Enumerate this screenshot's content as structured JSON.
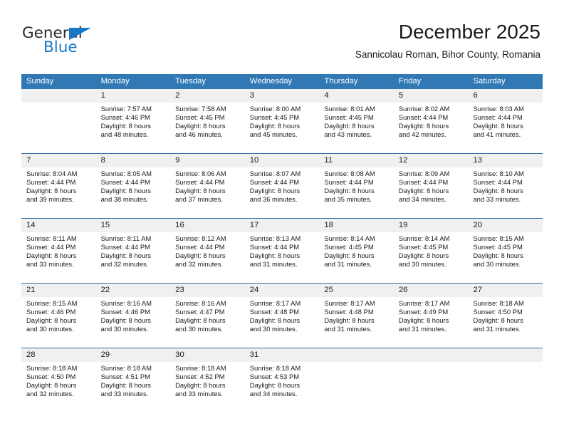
{
  "logo": {
    "word_top": "General",
    "word_bottom": "Blue",
    "brand_color": "#1878c8",
    "triangle_icon": "triangle-icon"
  },
  "header": {
    "month_title": "December 2025",
    "location": "Sannicolau Roman, Bihor County, Romania"
  },
  "calendar": {
    "header_bg": "#3079b5",
    "daynum_bg": "#f0f0f0",
    "grid_line_color": "#2f6fa8",
    "weekdays": [
      "Sunday",
      "Monday",
      "Tuesday",
      "Wednesday",
      "Thursday",
      "Friday",
      "Saturday"
    ],
    "weeks": [
      [
        {
          "day": "",
          "lines": []
        },
        {
          "day": "1",
          "lines": [
            "Sunrise: 7:57 AM",
            "Sunset: 4:46 PM",
            "Daylight: 8 hours",
            "and 48 minutes."
          ]
        },
        {
          "day": "2",
          "lines": [
            "Sunrise: 7:58 AM",
            "Sunset: 4:45 PM",
            "Daylight: 8 hours",
            "and 46 minutes."
          ]
        },
        {
          "day": "3",
          "lines": [
            "Sunrise: 8:00 AM",
            "Sunset: 4:45 PM",
            "Daylight: 8 hours",
            "and 45 minutes."
          ]
        },
        {
          "day": "4",
          "lines": [
            "Sunrise: 8:01 AM",
            "Sunset: 4:45 PM",
            "Daylight: 8 hours",
            "and 43 minutes."
          ]
        },
        {
          "day": "5",
          "lines": [
            "Sunrise: 8:02 AM",
            "Sunset: 4:44 PM",
            "Daylight: 8 hours",
            "and 42 minutes."
          ]
        },
        {
          "day": "6",
          "lines": [
            "Sunrise: 8:03 AM",
            "Sunset: 4:44 PM",
            "Daylight: 8 hours",
            "and 41 minutes."
          ]
        }
      ],
      [
        {
          "day": "7",
          "lines": [
            "Sunrise: 8:04 AM",
            "Sunset: 4:44 PM",
            "Daylight: 8 hours",
            "and 39 minutes."
          ]
        },
        {
          "day": "8",
          "lines": [
            "Sunrise: 8:05 AM",
            "Sunset: 4:44 PM",
            "Daylight: 8 hours",
            "and 38 minutes."
          ]
        },
        {
          "day": "9",
          "lines": [
            "Sunrise: 8:06 AM",
            "Sunset: 4:44 PM",
            "Daylight: 8 hours",
            "and 37 minutes."
          ]
        },
        {
          "day": "10",
          "lines": [
            "Sunrise: 8:07 AM",
            "Sunset: 4:44 PM",
            "Daylight: 8 hours",
            "and 36 minutes."
          ]
        },
        {
          "day": "11",
          "lines": [
            "Sunrise: 8:08 AM",
            "Sunset: 4:44 PM",
            "Daylight: 8 hours",
            "and 35 minutes."
          ]
        },
        {
          "day": "12",
          "lines": [
            "Sunrise: 8:09 AM",
            "Sunset: 4:44 PM",
            "Daylight: 8 hours",
            "and 34 minutes."
          ]
        },
        {
          "day": "13",
          "lines": [
            "Sunrise: 8:10 AM",
            "Sunset: 4:44 PM",
            "Daylight: 8 hours",
            "and 33 minutes."
          ]
        }
      ],
      [
        {
          "day": "14",
          "lines": [
            "Sunrise: 8:11 AM",
            "Sunset: 4:44 PM",
            "Daylight: 8 hours",
            "and 33 minutes."
          ]
        },
        {
          "day": "15",
          "lines": [
            "Sunrise: 8:11 AM",
            "Sunset: 4:44 PM",
            "Daylight: 8 hours",
            "and 32 minutes."
          ]
        },
        {
          "day": "16",
          "lines": [
            "Sunrise: 8:12 AM",
            "Sunset: 4:44 PM",
            "Daylight: 8 hours",
            "and 32 minutes."
          ]
        },
        {
          "day": "17",
          "lines": [
            "Sunrise: 8:13 AM",
            "Sunset: 4:44 PM",
            "Daylight: 8 hours",
            "and 31 minutes."
          ]
        },
        {
          "day": "18",
          "lines": [
            "Sunrise: 8:14 AM",
            "Sunset: 4:45 PM",
            "Daylight: 8 hours",
            "and 31 minutes."
          ]
        },
        {
          "day": "19",
          "lines": [
            "Sunrise: 8:14 AM",
            "Sunset: 4:45 PM",
            "Daylight: 8 hours",
            "and 30 minutes."
          ]
        },
        {
          "day": "20",
          "lines": [
            "Sunrise: 8:15 AM",
            "Sunset: 4:45 PM",
            "Daylight: 8 hours",
            "and 30 minutes."
          ]
        }
      ],
      [
        {
          "day": "21",
          "lines": [
            "Sunrise: 8:15 AM",
            "Sunset: 4:46 PM",
            "Daylight: 8 hours",
            "and 30 minutes."
          ]
        },
        {
          "day": "22",
          "lines": [
            "Sunrise: 8:16 AM",
            "Sunset: 4:46 PM",
            "Daylight: 8 hours",
            "and 30 minutes."
          ]
        },
        {
          "day": "23",
          "lines": [
            "Sunrise: 8:16 AM",
            "Sunset: 4:47 PM",
            "Daylight: 8 hours",
            "and 30 minutes."
          ]
        },
        {
          "day": "24",
          "lines": [
            "Sunrise: 8:17 AM",
            "Sunset: 4:48 PM",
            "Daylight: 8 hours",
            "and 30 minutes."
          ]
        },
        {
          "day": "25",
          "lines": [
            "Sunrise: 8:17 AM",
            "Sunset: 4:48 PM",
            "Daylight: 8 hours",
            "and 31 minutes."
          ]
        },
        {
          "day": "26",
          "lines": [
            "Sunrise: 8:17 AM",
            "Sunset: 4:49 PM",
            "Daylight: 8 hours",
            "and 31 minutes."
          ]
        },
        {
          "day": "27",
          "lines": [
            "Sunrise: 8:18 AM",
            "Sunset: 4:50 PM",
            "Daylight: 8 hours",
            "and 31 minutes."
          ]
        }
      ],
      [
        {
          "day": "28",
          "lines": [
            "Sunrise: 8:18 AM",
            "Sunset: 4:50 PM",
            "Daylight: 8 hours",
            "and 32 minutes."
          ]
        },
        {
          "day": "29",
          "lines": [
            "Sunrise: 8:18 AM",
            "Sunset: 4:51 PM",
            "Daylight: 8 hours",
            "and 33 minutes."
          ]
        },
        {
          "day": "30",
          "lines": [
            "Sunrise: 8:18 AM",
            "Sunset: 4:52 PM",
            "Daylight: 8 hours",
            "and 33 minutes."
          ]
        },
        {
          "day": "31",
          "lines": [
            "Sunrise: 8:18 AM",
            "Sunset: 4:53 PM",
            "Daylight: 8 hours",
            "and 34 minutes."
          ]
        },
        {
          "day": "",
          "lines": []
        },
        {
          "day": "",
          "lines": []
        },
        {
          "day": "",
          "lines": []
        }
      ]
    ]
  }
}
